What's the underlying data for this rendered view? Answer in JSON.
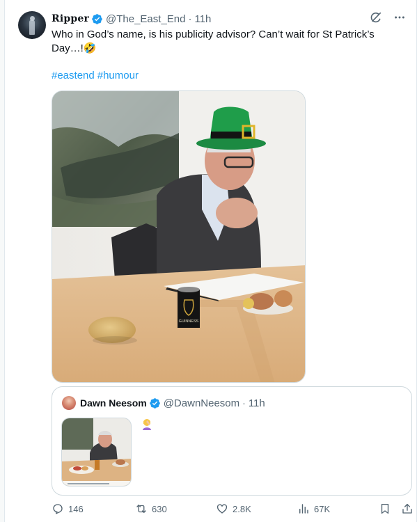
{
  "post": {
    "display_name": "Ripper",
    "handle": "@The_East_End",
    "separator": "·",
    "time": "11h",
    "text": "Who in God’s name, is his publicity advisor? Can’t wait for St Patrick’s Day…!🤣",
    "hashtags": [
      "#eastend",
      "#humour"
    ],
    "image_can_label": "GUINNESS"
  },
  "quote": {
    "display_name": "Dawn Neesom",
    "handle": "@DawnNeesom",
    "separator": "·",
    "time": "11h",
    "emoji": "🤦‍♀️"
  },
  "engagement": {
    "replies": "146",
    "reposts": "630",
    "likes": "2.8K",
    "views": "67K"
  },
  "icons": {
    "verified": "verified-badge-icon",
    "grok": "grok-icon",
    "more": "more-icon",
    "reply": "reply-icon",
    "repost": "repost-icon",
    "like": "like-icon",
    "views": "views-icon",
    "bookmark": "bookmark-icon",
    "share": "share-icon"
  },
  "colors": {
    "accent": "#1d9bf0",
    "text": "#0f1419",
    "secondary": "#536471",
    "border": "#cfd9de"
  }
}
